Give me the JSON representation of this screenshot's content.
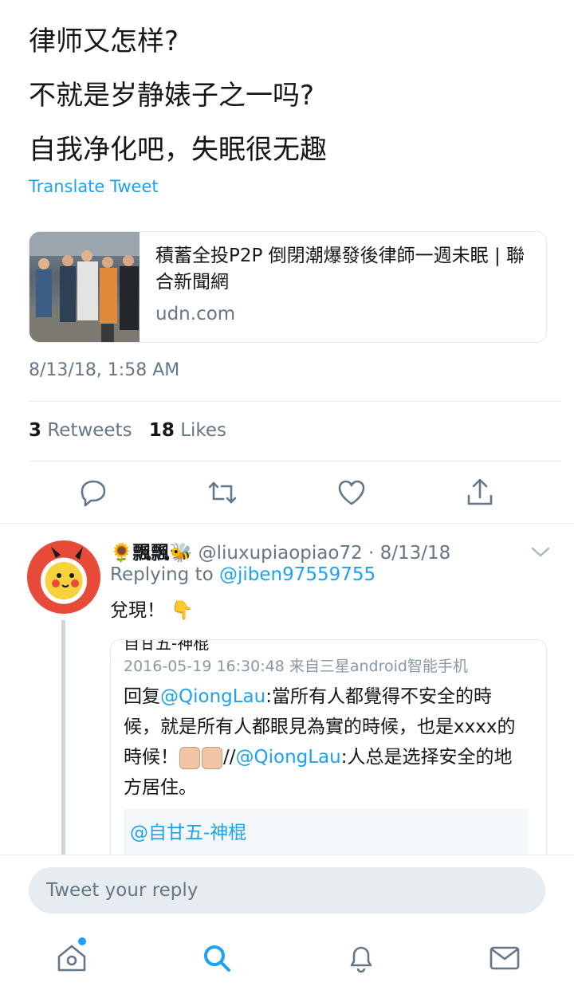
{
  "tweet": {
    "lines": [
      "律师又怎样?",
      "不就是岁静婊子之一吗?",
      "自我净化吧，失眠很无趣"
    ],
    "translate_label": "Translate Tweet",
    "card": {
      "title": "積蓄全投P2P 倒閉潮爆發後律師一週未眠 | 聯合新聞網",
      "domain": "udn.com"
    },
    "timestamp": "8/13/18, 1:58 AM",
    "retweets_count": "3",
    "retweets_label": "Retweets",
    "likes_count": "18",
    "likes_label": "Likes",
    "actions": [
      "reply-icon",
      "retweet-icon",
      "heart-icon",
      "share-icon"
    ]
  },
  "reply": {
    "name": "🌻飄飄🐝",
    "handle": "@liuxupiaopiao72",
    "date": "· 8/13/18",
    "replying_prefix": "Replying to",
    "replying_to": "@jiben97559755",
    "text": "兌現！ 👇",
    "embed": {
      "cut_header": "自甘五-神棍",
      "meta": "2016-05-19 16:30:48  来自三星android智能手机",
      "body_1": "回复",
      "mention_1": "@QiongLau",
      "body_2": ":當所有人都覺得不安全的時候，就是所有人都眼見為實的時候，也是xxxx的時候！",
      "body_3": "//",
      "mention_2": "@QiongLau",
      "body_4": ":人总是选择安全的地方居住。",
      "quote_mention": "@自甘五-神棍"
    }
  },
  "composer": {
    "placeholder": "Tweet your reply"
  },
  "tabbar": [
    "home-icon",
    "search-icon",
    "notifications-icon",
    "messages-icon"
  ],
  "colors": {
    "accent": "#1da1f2",
    "text": "#14171a",
    "muted": "#657786",
    "border": "#e6ecf0"
  }
}
